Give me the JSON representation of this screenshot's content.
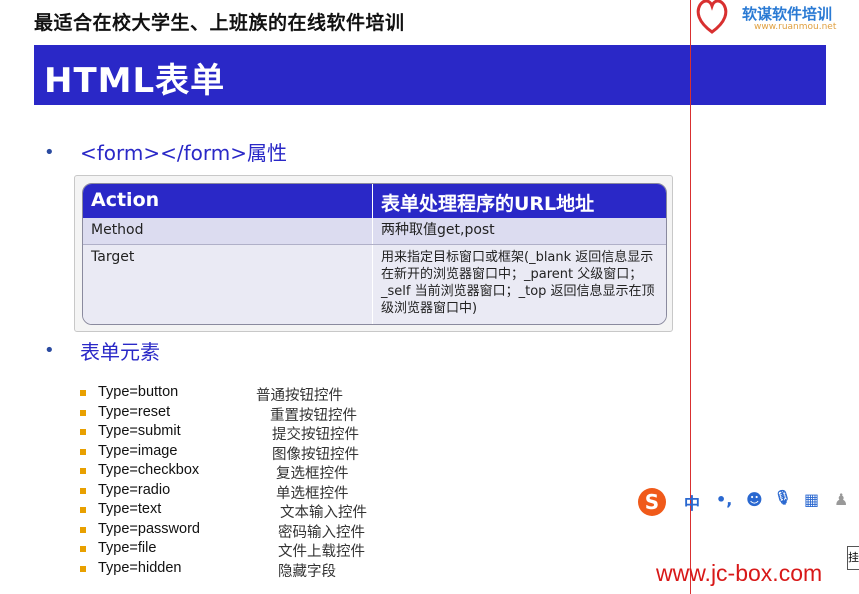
{
  "header": {
    "slogan": "最适合在校大学生、上班族的在线软件培训"
  },
  "logo": {
    "name": "软谋软件培训",
    "url": "www.ruanmou.net"
  },
  "title": "HTML表单",
  "section1": {
    "heading": "<form></form>属性"
  },
  "table": {
    "headers": [
      "Action",
      "表单处理程序的URL地址"
    ],
    "rows": [
      [
        "Method",
        "两种取值get,post"
      ],
      [
        "Target",
        "用来指定目标窗口或框架(_blank 返回信息显示在新开的浏览器窗口中；_parent 父级窗口；_self 当前浏览器窗口；_top 返回信息显示在顶级浏览器窗口中)"
      ]
    ]
  },
  "section2": {
    "heading": "表单元素"
  },
  "elements": [
    {
      "type": "Type=button",
      "desc": "普通按钮控件"
    },
    {
      "type": "Type=reset",
      "desc": "重置按钮控件"
    },
    {
      "type": "Type=submit",
      "desc": "提交按钮控件"
    },
    {
      "type": "Type=image",
      "desc": "图像按钮控件"
    },
    {
      "type": "Type=checkbox",
      "desc": "复选框控件"
    },
    {
      "type": "Type=radio",
      "desc": "单选框控件"
    },
    {
      "type": "Type=text",
      "desc": "文本输入控件"
    },
    {
      "type": "Type=password",
      "desc": "密码输入控件"
    },
    {
      "type": "Type=file",
      "desc": "文件上载控件"
    },
    {
      "type": "Type=hidden",
      "desc": "隐藏字段"
    }
  ],
  "ime": {
    "logo": "S",
    "mode": "中",
    "punct": "•,",
    "emoji": "☻",
    "voice": "🎙",
    "keyboard": "▦",
    "user": "♟"
  },
  "watermark": "www.jc-box.com",
  "edge_char": "挂",
  "colors": {
    "title_bar": "#2a28c7",
    "bullet_text": "#2a28c7",
    "list_bullet": "#e8a000",
    "watermark": "#d81818",
    "guide_line": "#d93030"
  }
}
